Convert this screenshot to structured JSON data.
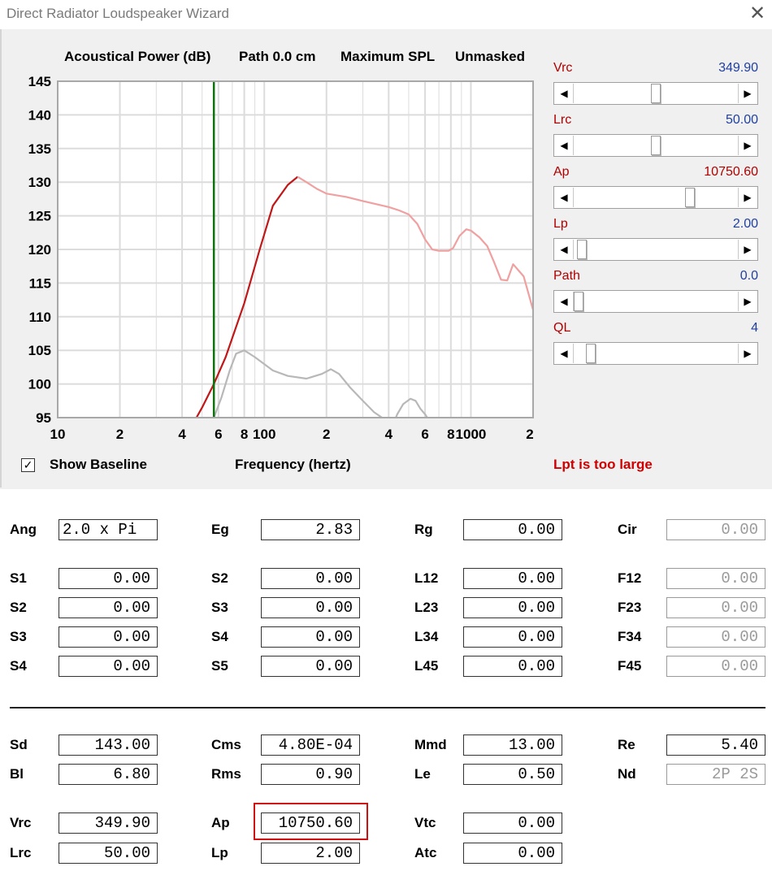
{
  "window": {
    "title": "Direct Radiator Loudspeaker Wizard",
    "close_glyph": "✕"
  },
  "chart_header": {
    "power": "Acoustical Power (dB)",
    "path": "Path 0.0 cm",
    "spl": "Maximum SPL",
    "mask": "Unmasked"
  },
  "chart_data": {
    "type": "line",
    "title": "Acoustical Power (dB)",
    "xlabel": "Frequency (hertz)",
    "ylabel": "",
    "x_scale": "log",
    "xlim": [
      10,
      2000
    ],
    "ylim": [
      95,
      145
    ],
    "y_ticks": [
      145,
      140,
      135,
      130,
      125,
      120,
      115,
      110,
      105,
      100,
      95
    ],
    "x_ticks": [
      {
        "v": 10,
        "label": "10"
      },
      {
        "v": 20,
        "label": "2"
      },
      {
        "v": 40,
        "label": "4"
      },
      {
        "v": 60,
        "label": "6"
      },
      {
        "v": 80,
        "label": "8"
      },
      {
        "v": 100,
        "label": "100"
      },
      {
        "v": 200,
        "label": "2"
      },
      {
        "v": 400,
        "label": "4"
      },
      {
        "v": 600,
        "label": "6"
      },
      {
        "v": 800,
        "label": "8"
      },
      {
        "v": 1000,
        "label": "1000"
      },
      {
        "v": 2000,
        "label": "2"
      }
    ],
    "grid": true,
    "vertical_marker": {
      "x": 57,
      "color": "#107010"
    },
    "series": [
      {
        "color": "#c01818",
        "x": [
          40,
          45,
          50,
          57,
          65,
          80,
          95,
          110,
          130,
          145
        ],
        "y": [
          91.8,
          94,
          96.5,
          100,
          104,
          112,
          120,
          126.5,
          129.6,
          130.8
        ]
      },
      {
        "color": "#f0a0a0",
        "x": [
          145,
          160,
          180,
          200,
          250,
          300,
          400,
          450,
          500,
          550,
          600,
          650,
          700,
          780,
          820,
          880,
          950,
          1000,
          1100,
          1200,
          1300,
          1400,
          1500,
          1600,
          1800,
          2000
        ],
        "y": [
          130.8,
          130,
          129,
          128.3,
          127.8,
          127.2,
          126.3,
          125.8,
          125.2,
          123.8,
          121.5,
          120,
          119.8,
          119.8,
          120.2,
          122,
          123,
          122.8,
          121.8,
          120.5,
          118,
          115.5,
          115.4,
          117.8,
          116,
          111
        ]
      },
      {
        "color": "#b8b8b8",
        "x": [
          57,
          62,
          68,
          73,
          80,
          90,
          110,
          130,
          160,
          190,
          210,
          230,
          260,
          300,
          340,
          380,
          400
        ],
        "y": [
          95,
          98,
          102,
          104.5,
          105,
          104,
          102,
          101.2,
          100.8,
          101.5,
          102.2,
          101.5,
          99.5,
          97.5,
          95.8,
          94.8,
          94.3
        ]
      },
      {
        "color": "#b8b8b8",
        "x": [
          420,
          440,
          470,
          510,
          540,
          570,
          600,
          630
        ],
        "y": [
          94,
          95.5,
          97,
          97.8,
          97.5,
          96.3,
          95.5,
          94.5
        ]
      }
    ]
  },
  "sliders": [
    {
      "name": "vrc",
      "label": "Vrc",
      "value": "349.90",
      "pos": 0.5
    },
    {
      "name": "lrc",
      "label": "Lrc",
      "value": "50.00",
      "pos": 0.5
    },
    {
      "name": "ap",
      "label": "Ap",
      "value": "10750.60",
      "pos": 0.72
    },
    {
      "name": "lp",
      "label": "Lp",
      "value": "2.00",
      "pos": 0.02
    },
    {
      "name": "path",
      "label": "Path",
      "value": "0.0",
      "pos": 0.0
    },
    {
      "name": "ql",
      "label": "QL",
      "value": "4",
      "pos": 0.08
    }
  ],
  "show_baseline": {
    "checked_glyph": "✓",
    "label": "Show Baseline"
  },
  "status": {
    "warning": "Lpt is too large"
  },
  "params": {
    "ang": {
      "label": "Ang",
      "value": "2.0 x Pi"
    },
    "eg": {
      "label": "Eg",
      "value": "2.83"
    },
    "rg": {
      "label": "Rg",
      "value": "0.00"
    },
    "cir": {
      "label": "Cir",
      "value": "0.00"
    },
    "s1a": {
      "label": "S1",
      "value": "0.00"
    },
    "s2a": {
      "label": "S2",
      "value": "0.00"
    },
    "s3a": {
      "label": "S3",
      "value": "0.00"
    },
    "s4a": {
      "label": "S4",
      "value": "0.00"
    },
    "s2b": {
      "label": "S2",
      "value": "0.00"
    },
    "s3b": {
      "label": "S3",
      "value": "0.00"
    },
    "s4b": {
      "label": "S4",
      "value": "0.00"
    },
    "s5b": {
      "label": "S5",
      "value": "0.00"
    },
    "l12": {
      "label": "L12",
      "value": "0.00"
    },
    "l23": {
      "label": "L23",
      "value": "0.00"
    },
    "l34": {
      "label": "L34",
      "value": "0.00"
    },
    "l45": {
      "label": "L45",
      "value": "0.00"
    },
    "f12": {
      "label": "F12",
      "value": "0.00"
    },
    "f23": {
      "label": "F23",
      "value": "0.00"
    },
    "f34": {
      "label": "F34",
      "value": "0.00"
    },
    "f45": {
      "label": "F45",
      "value": "0.00"
    },
    "sd": {
      "label": "Sd",
      "value": "143.00"
    },
    "bl": {
      "label": "Bl",
      "value": "6.80"
    },
    "cms": {
      "label": "Cms",
      "value": "4.80E-04"
    },
    "rms": {
      "label": "Rms",
      "value": "0.90"
    },
    "mmd": {
      "label": "Mmd",
      "value": "13.00"
    },
    "le": {
      "label": "Le",
      "value": "0.50"
    },
    "re": {
      "label": "Re",
      "value": "5.40"
    },
    "nd": {
      "label": "Nd",
      "value": "2P 2S"
    },
    "vrc": {
      "label": "Vrc",
      "value": "349.90"
    },
    "lrc": {
      "label": "Lrc",
      "value": "50.00"
    },
    "ap": {
      "label": "Ap",
      "value": "10750.60"
    },
    "lp": {
      "label": "Lp",
      "value": "2.00"
    },
    "vtc": {
      "label": "Vtc",
      "value": "0.00"
    },
    "atc": {
      "label": "Atc",
      "value": "0.00"
    }
  }
}
